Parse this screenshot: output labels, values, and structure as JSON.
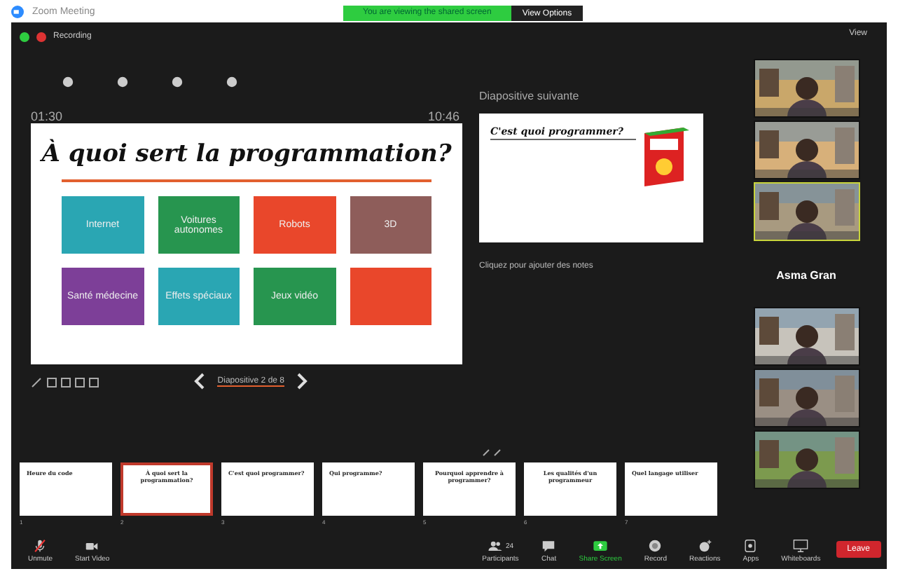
{
  "window": {
    "title": "Zoom Meeting"
  },
  "share_banner": {
    "text": "You are viewing the shared screen",
    "button": "View Options"
  },
  "recording": {
    "label": "Recording",
    "on": true
  },
  "view_button": "View",
  "presenter": {
    "timer": "01:30",
    "clock": "10:46",
    "slide": {
      "title": "À quoi sert la programmation?",
      "tiles": [
        {
          "label": "Internet",
          "color": "#2aa6b3"
        },
        {
          "label": "Voitures autonomes",
          "color": "#27954f"
        },
        {
          "label": "Robots",
          "color": "#e9472b"
        },
        {
          "label": "3D",
          "color": "#8e5d5a"
        },
        {
          "label": "Santé médecine",
          "color": "#7d3f98"
        },
        {
          "label": "Effets spéciaux",
          "color": "#2aa6b3"
        },
        {
          "label": "Jeux vidéo",
          "color": "#27954f"
        },
        {
          "color": "#e9472b"
        }
      ]
    },
    "nav": "Diapositive 2 de 8",
    "next_label": "Diapositive suivante",
    "next_title": "C'est quoi programmer?",
    "notes": "Cliquez pour ajouter des notes"
  },
  "thumbnails": [
    {
      "number": "1",
      "title": "Heure du code",
      "selected": false
    },
    {
      "number": "2",
      "title": "À quoi sert la programmation?",
      "selected": true
    },
    {
      "number": "3",
      "title": "C'est quoi programmer?",
      "selected": false
    },
    {
      "number": "4",
      "title": "Qui programme?",
      "selected": false
    },
    {
      "number": "5",
      "title": "Pourquoi apprendre à programmer?",
      "selected": false
    },
    {
      "number": "6",
      "title": "Les qualités d'un programmeur",
      "selected": false
    },
    {
      "number": "7",
      "title": "Quel langage utiliser",
      "selected": false
    }
  ],
  "participants": {
    "top": [
      {
        "active": false
      },
      {
        "active": false
      },
      {
        "active": true
      }
    ],
    "featured": "Asma Gran",
    "bottom": [
      {
        "active": false
      },
      {
        "active": false
      },
      {
        "active": false
      }
    ]
  },
  "toolbar": [
    {
      "label": "Unmute",
      "kind": "mic"
    },
    {
      "label": "Start Video",
      "kind": "video"
    },
    {
      "label": "Participants",
      "kind": "people",
      "count": "24"
    },
    {
      "label": "Chat",
      "kind": "chat"
    },
    {
      "label": "Share Screen",
      "kind": "share"
    },
    {
      "label": "Record",
      "kind": "record"
    },
    {
      "label": "Reactions",
      "kind": "reactions"
    },
    {
      "label": "Apps",
      "kind": "apps"
    },
    {
      "label": "Whiteboards",
      "kind": "whiteboard"
    }
  ],
  "leave": "Leave"
}
